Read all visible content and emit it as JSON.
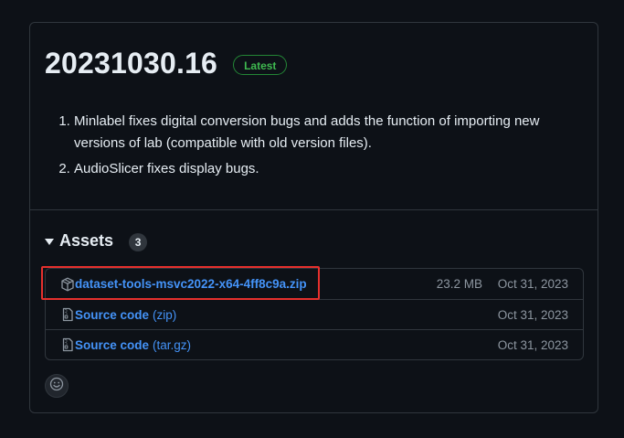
{
  "release": {
    "version": "20231030.16",
    "badge": "Latest",
    "notes": [
      "Minlabel fixes digital conversion bugs and adds the function of importing new versions of lab (compatible with old version files).",
      "AudioSlicer fixes display bugs."
    ]
  },
  "assets": {
    "title": "Assets",
    "count": "3",
    "items": [
      {
        "icon": "package-icon",
        "name": "dataset-tools-msvc2022-x64-4ff8c9a.zip",
        "suffix": "",
        "size": "23.2 MB",
        "date": "Oct 31, 2023"
      },
      {
        "icon": "file-zip-icon",
        "name": "Source code",
        "suffix": "(zip)",
        "size": "",
        "date": "Oct 31, 2023"
      },
      {
        "icon": "file-zip-icon",
        "name": "Source code",
        "suffix": "(tar.gz)",
        "size": "",
        "date": "Oct 31, 2023"
      }
    ]
  },
  "reactions": {
    "icon": "smiley-icon"
  },
  "colors": {
    "background": "#0d1117",
    "border": "#30363d",
    "link": "#4493f8",
    "badge_green": "#3fb950",
    "highlight_red": "#e5302d",
    "muted": "#8d96a0"
  }
}
